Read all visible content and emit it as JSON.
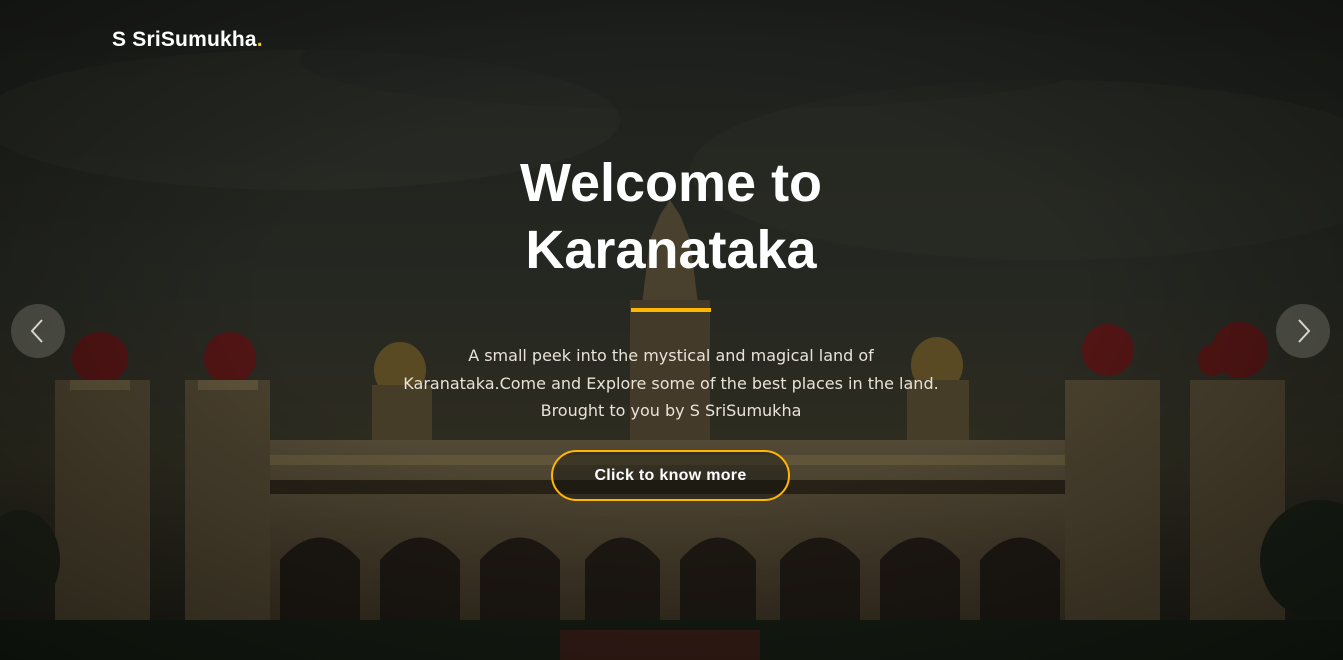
{
  "brand": {
    "name": "S SriSumukha",
    "dot": ".",
    "accent_color": "#ffb703"
  },
  "hero": {
    "title_line1": "Welcome to",
    "title_line2": "Karanataka",
    "description": "A small peek into the mystical and magical land of Karanataka.Come and Explore some of the best places in the land. Brought to you by S SriSumukha",
    "cta_label": "Click to know more",
    "background_image": "palace-photo"
  },
  "carousel": {
    "prev_icon": "chevron-left-icon",
    "next_icon": "chevron-right-icon"
  }
}
